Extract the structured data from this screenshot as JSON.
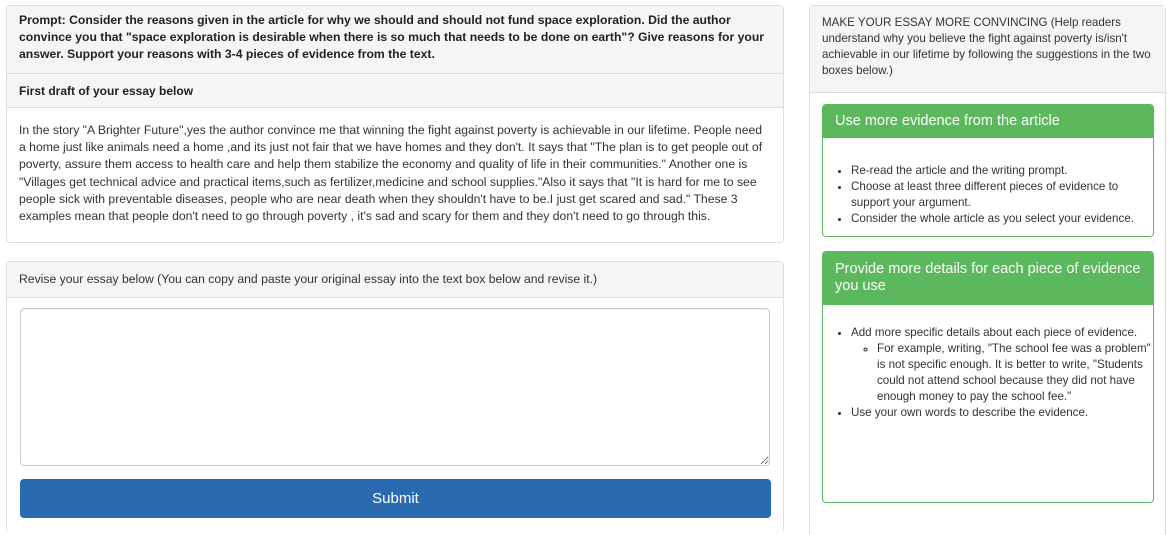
{
  "prompt": {
    "text": "Prompt: Consider the reasons given in the article for why we should and should not fund space exploration. Did the author convince you that \"space exploration is desirable when there is so much that needs to be done on earth\"? Give reasons for your answer. Support your reasons with 3-4 pieces of evidence from the text.",
    "draft_heading": "First draft of your essay below",
    "draft_text": "In the story \"A Brighter Future\",yes the author convince me that winning the fight against poverty is achievable in our lifetime. People need a home just like animals need a home ,and its just not fair that we have homes and they don't. It says that \"The plan is to get people out of poverty, assure them access to health care and help them stabilize the economy and quality of life in their communities.\" Another one is \"Villages get technical advice and practical items,such as fertilizer,medicine and school supplies.\"Also it says that \"It is hard for me to see people sick with preventable diseases, people who are near death when they shouldn't have to be.I just get scared and sad.\" These 3 examples mean that people don't need to go through poverty , it's sad and scary for them and they don't need to go through this."
  },
  "revise": {
    "heading": "Revise your essay below (You can copy and paste your original essay into the text box below and revise it.)",
    "input_value": "",
    "submit_label": "Submit"
  },
  "sidebar": {
    "heading": "MAKE YOUR ESSAY MORE CONVINCING (Help readers understand why you believe the fight against poverty is/isn't achievable in our lifetime by following the suggestions in the two boxes below.)",
    "card1": {
      "title": "Use more evidence from the article",
      "items": [
        "Re-read the article and the writing prompt.",
        "Choose at least three different pieces of evidence to support your argument.",
        "Consider the whole article as you select your evidence."
      ]
    },
    "card2": {
      "title": "Provide more details for each piece of evidence you use",
      "item1": "Add more specific details about each piece of evidence.",
      "subitem": "For example, writing, \"The school fee was a problem\" is not specific enough. It is better to write, \"Students could not attend school because they did not have enough money to pay the school fee.\"",
      "item2": "Use your own words to describe the evidence."
    },
    "accent_color": "#5cb85c",
    "button_color": "#2a6ab0"
  }
}
